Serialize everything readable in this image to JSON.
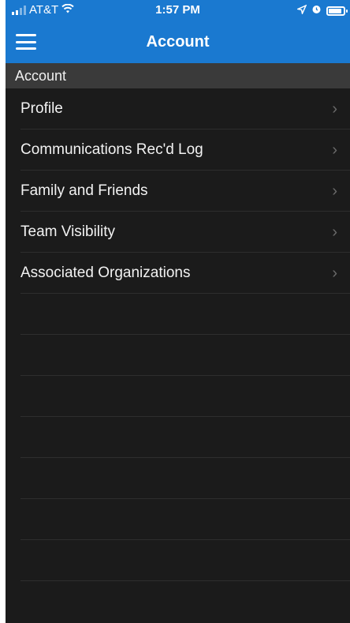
{
  "status_bar": {
    "carrier": "AT&T",
    "time": "1:57 PM"
  },
  "nav": {
    "title": "Account"
  },
  "section": {
    "title": "Account"
  },
  "items": [
    {
      "label": "Profile"
    },
    {
      "label": "Communications Rec'd Log"
    },
    {
      "label": "Family and Friends"
    },
    {
      "label": "Team Visibility"
    },
    {
      "label": "Associated Organizations"
    }
  ],
  "icons": {
    "menu": "hamburger-menu-icon",
    "chevron": "chevron-right-icon",
    "wifi": "wifi-icon",
    "location": "location-arrow-icon",
    "alarm": "alarm-icon",
    "battery": "battery-icon"
  }
}
